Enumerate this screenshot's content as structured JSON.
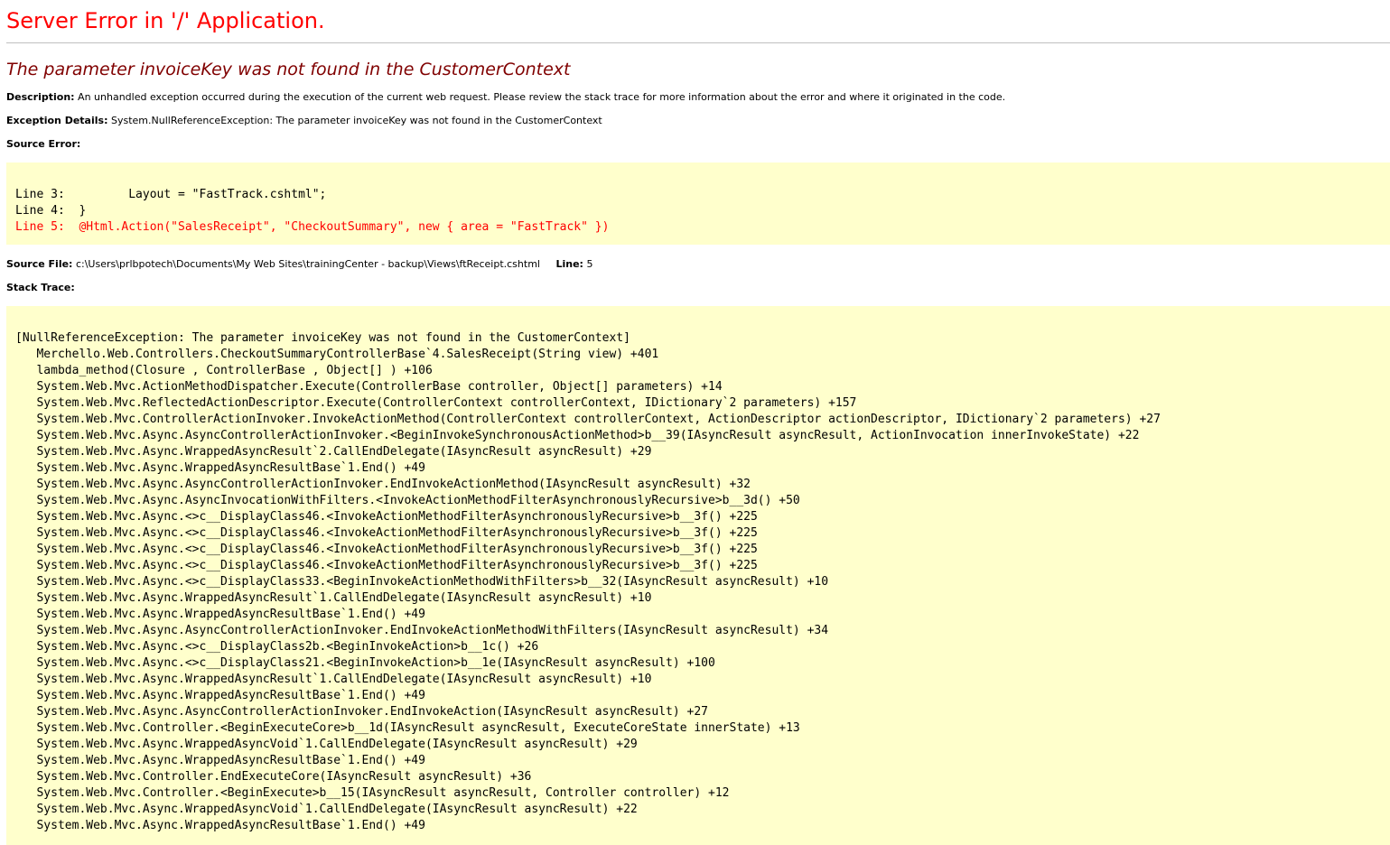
{
  "page": {
    "title": "Server Error in '/' Application.",
    "subtitle": "The parameter invoiceKey was not found in the CustomerContext"
  },
  "description": {
    "label": "Description:",
    "text": "An unhandled exception occurred during the execution of the current web request. Please review the stack trace for more information about the error and where it originated in the code."
  },
  "exception": {
    "label": "Exception Details:",
    "text": "System.NullReferenceException: The parameter invoiceKey was not found in the CustomerContext"
  },
  "source_error": {
    "label": "Source Error:",
    "lines": [
      "Line 3:         Layout = \"FastTrack.cshtml\";",
      "Line 4:  }",
      "Line 5:  @Html.Action(\"SalesReceipt\", \"CheckoutSummary\", new { area = \"FastTrack\" })"
    ]
  },
  "source_file": {
    "label": "Source File:",
    "path": "c:\\Users\\prlbpotech\\Documents\\My Web Sites\\trainingCenter - backup\\Views\\ftReceipt.cshtml",
    "line_label": "Line:",
    "line_number": "5"
  },
  "stack_trace": {
    "label": "Stack Trace:",
    "lines": [
      "[NullReferenceException: The parameter invoiceKey was not found in the CustomerContext]",
      "   Merchello.Web.Controllers.CheckoutSummaryControllerBase`4.SalesReceipt(String view) +401",
      "   lambda_method(Closure , ControllerBase , Object[] ) +106",
      "   System.Web.Mvc.ActionMethodDispatcher.Execute(ControllerBase controller, Object[] parameters) +14",
      "   System.Web.Mvc.ReflectedActionDescriptor.Execute(ControllerContext controllerContext, IDictionary`2 parameters) +157",
      "   System.Web.Mvc.ControllerActionInvoker.InvokeActionMethod(ControllerContext controllerContext, ActionDescriptor actionDescriptor, IDictionary`2 parameters) +27",
      "   System.Web.Mvc.Async.AsyncControllerActionInvoker.<BeginInvokeSynchronousActionMethod>b__39(IAsyncResult asyncResult, ActionInvocation innerInvokeState) +22",
      "   System.Web.Mvc.Async.WrappedAsyncResult`2.CallEndDelegate(IAsyncResult asyncResult) +29",
      "   System.Web.Mvc.Async.WrappedAsyncResultBase`1.End() +49",
      "   System.Web.Mvc.Async.AsyncControllerActionInvoker.EndInvokeActionMethod(IAsyncResult asyncResult) +32",
      "   System.Web.Mvc.Async.AsyncInvocationWithFilters.<InvokeActionMethodFilterAsynchronouslyRecursive>b__3d() +50",
      "   System.Web.Mvc.Async.<>c__DisplayClass46.<InvokeActionMethodFilterAsynchronouslyRecursive>b__3f() +225",
      "   System.Web.Mvc.Async.<>c__DisplayClass46.<InvokeActionMethodFilterAsynchronouslyRecursive>b__3f() +225",
      "   System.Web.Mvc.Async.<>c__DisplayClass46.<InvokeActionMethodFilterAsynchronouslyRecursive>b__3f() +225",
      "   System.Web.Mvc.Async.<>c__DisplayClass46.<InvokeActionMethodFilterAsynchronouslyRecursive>b__3f() +225",
      "   System.Web.Mvc.Async.<>c__DisplayClass33.<BeginInvokeActionMethodWithFilters>b__32(IAsyncResult asyncResult) +10",
      "   System.Web.Mvc.Async.WrappedAsyncResult`1.CallEndDelegate(IAsyncResult asyncResult) +10",
      "   System.Web.Mvc.Async.WrappedAsyncResultBase`1.End() +49",
      "   System.Web.Mvc.Async.AsyncControllerActionInvoker.EndInvokeActionMethodWithFilters(IAsyncResult asyncResult) +34",
      "   System.Web.Mvc.Async.<>c__DisplayClass2b.<BeginInvokeAction>b__1c() +26",
      "   System.Web.Mvc.Async.<>c__DisplayClass21.<BeginInvokeAction>b__1e(IAsyncResult asyncResult) +100",
      "   System.Web.Mvc.Async.WrappedAsyncResult`1.CallEndDelegate(IAsyncResult asyncResult) +10",
      "   System.Web.Mvc.Async.WrappedAsyncResultBase`1.End() +49",
      "   System.Web.Mvc.Async.AsyncControllerActionInvoker.EndInvokeAction(IAsyncResult asyncResult) +27",
      "   System.Web.Mvc.Controller.<BeginExecuteCore>b__1d(IAsyncResult asyncResult, ExecuteCoreState innerState) +13",
      "   System.Web.Mvc.Async.WrappedAsyncVoid`1.CallEndDelegate(IAsyncResult asyncResult) +29",
      "   System.Web.Mvc.Async.WrappedAsyncResultBase`1.End() +49",
      "   System.Web.Mvc.Controller.EndExecuteCore(IAsyncResult asyncResult) +36",
      "   System.Web.Mvc.Controller.<BeginExecute>b__15(IAsyncResult asyncResult, Controller controller) +12",
      "   System.Web.Mvc.Async.WrappedAsyncVoid`1.CallEndDelegate(IAsyncResult asyncResult) +22",
      "   System.Web.Mvc.Async.WrappedAsyncResultBase`1.End() +49"
    ]
  },
  "colors": {
    "title": "#ff0000",
    "subtitle": "#800000",
    "code_background": "#ffffcc",
    "error_line": "#ff0000"
  }
}
